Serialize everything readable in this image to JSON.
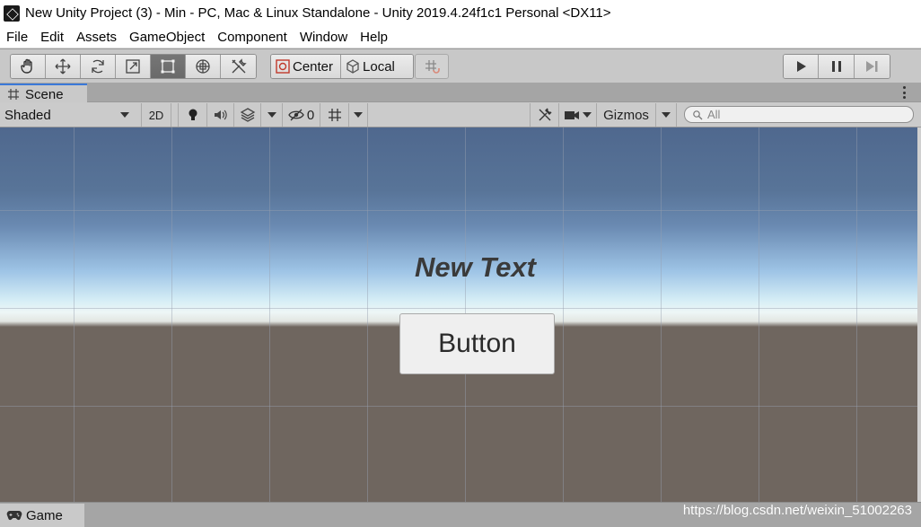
{
  "window": {
    "title": "New Unity Project (3) - Min - PC, Mac & Linux Standalone - Unity 2019.4.24f1c1 Personal <DX11>"
  },
  "menu": {
    "items": [
      "File",
      "Edit",
      "Assets",
      "GameObject",
      "Component",
      "Window",
      "Help"
    ]
  },
  "toolbar": {
    "tools": [
      "hand-icon",
      "move-icon",
      "rotate-icon",
      "scale-icon",
      "rect-icon",
      "transform-icon",
      "custom-tool-icon"
    ],
    "active_tool": "rect-icon",
    "pivot_label": "Center",
    "rotation_label": "Local",
    "snap_icon": "grid-snap-icon",
    "play_controls": [
      "play-icon",
      "pause-icon",
      "step-icon"
    ]
  },
  "scene_tab": {
    "label": "Scene",
    "icon": "grid-icon"
  },
  "scene_toolbar": {
    "draw_mode": "Shaded",
    "mode_2d": "2D",
    "hidden_count": "0",
    "gizmos_label": "Gizmos",
    "search_placeholder": "All"
  },
  "scene_view": {
    "text_object": "New Text",
    "button_label": "Button"
  },
  "game_tab": {
    "label": "Game",
    "icon": "gamepad-icon"
  },
  "watermark": "https://blog.csdn.net/weixin_51002263",
  "colors": {
    "accent_tab": "#3a79d8",
    "sky_top": "#4f688e",
    "ground": "#6f665f"
  }
}
